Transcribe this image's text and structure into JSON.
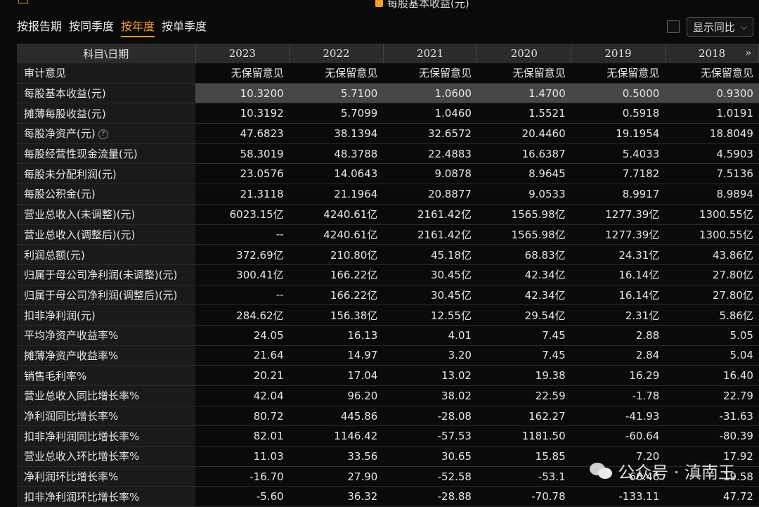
{
  "legend": {
    "right_label": "每股基本收益(元)",
    "right_color": "#f0a022"
  },
  "tabs": [
    {
      "label": "按报告期",
      "active": false
    },
    {
      "label": "按同季度",
      "active": false
    },
    {
      "label": "按年度",
      "active": true
    },
    {
      "label": "按单季度",
      "active": false
    }
  ],
  "controls": {
    "select_value": "显示同比",
    "caret": "⌵"
  },
  "table": {
    "header_label": "科目\\日期",
    "years": [
      "2023",
      "2022",
      "2021",
      "2020",
      "2019",
      "2018"
    ],
    "more_icon": "»",
    "rows": [
      {
        "label": "审计意见",
        "values": [
          "无保留意见",
          "无保留意见",
          "无保留意见",
          "无保留意见",
          "无保留意见",
          "无保留意见"
        ]
      },
      {
        "label": "每股基本收益(元)",
        "values": [
          "10.3200",
          "5.7100",
          "1.0600",
          "1.4700",
          "0.5000",
          "0.9300"
        ],
        "highlight": true
      },
      {
        "label": "摊薄每股收益(元)",
        "values": [
          "10.3192",
          "5.7099",
          "1.0460",
          "1.5521",
          "0.5918",
          "1.0191"
        ]
      },
      {
        "label": "每股净资产(元)",
        "values": [
          "47.6823",
          "38.1394",
          "32.6572",
          "20.4460",
          "19.1954",
          "18.8049"
        ],
        "info": true
      },
      {
        "label": "每股经营性现金流量(元)",
        "values": [
          "58.3019",
          "48.3788",
          "22.4883",
          "16.6387",
          "5.4033",
          "4.5903"
        ]
      },
      {
        "label": "每股未分配利润(元)",
        "values": [
          "23.0576",
          "14.0643",
          "9.0878",
          "8.9645",
          "7.7182",
          "7.5136"
        ]
      },
      {
        "label": "每股公积金(元)",
        "values": [
          "21.3118",
          "21.1964",
          "20.8877",
          "9.0533",
          "8.9917",
          "8.9894"
        ]
      },
      {
        "label": "营业总收入(未调整)(元)",
        "values": [
          "6023.15亿",
          "4240.61亿",
          "2161.42亿",
          "1565.98亿",
          "1277.39亿",
          "1300.55亿"
        ]
      },
      {
        "label": "营业总收入(调整后)(元)",
        "values": [
          "--",
          "4240.61亿",
          "2161.42亿",
          "1565.98亿",
          "1277.39亿",
          "1300.55亿"
        ]
      },
      {
        "label": "利润总额(元)",
        "values": [
          "372.69亿",
          "210.80亿",
          "45.18亿",
          "68.83亿",
          "24.31亿",
          "43.86亿"
        ]
      },
      {
        "label": "归属于母公司净利润(未调整)(元)",
        "values": [
          "300.41亿",
          "166.22亿",
          "30.45亿",
          "42.34亿",
          "16.14亿",
          "27.80亿"
        ]
      },
      {
        "label": "归属于母公司净利润(调整后)(元)",
        "values": [
          "--",
          "166.22亿",
          "30.45亿",
          "42.34亿",
          "16.14亿",
          "27.80亿"
        ]
      },
      {
        "label": "扣非净利润(元)",
        "values": [
          "284.62亿",
          "156.38亿",
          "12.55亿",
          "29.54亿",
          "2.31亿",
          "5.86亿"
        ]
      },
      {
        "label": "平均净资产收益率%",
        "values": [
          "24.05",
          "16.13",
          "4.01",
          "7.45",
          "2.88",
          "5.05"
        ]
      },
      {
        "label": "摊薄净资产收益率%",
        "values": [
          "21.64",
          "14.97",
          "3.20",
          "7.45",
          "2.84",
          "5.04"
        ]
      },
      {
        "label": "销售毛利率%",
        "values": [
          "20.21",
          "17.04",
          "13.02",
          "19.38",
          "16.29",
          "16.40"
        ]
      },
      {
        "label": "营业总收入同比增长率%",
        "values": [
          "42.04",
          "96.20",
          "38.02",
          "22.59",
          "-1.78",
          "22.79"
        ]
      },
      {
        "label": "净利润同比增长率%",
        "values": [
          "80.72",
          "445.86",
          "-28.08",
          "162.27",
          "-41.93",
          "-31.63"
        ]
      },
      {
        "label": "扣非净利润同比增长率%",
        "values": [
          "82.01",
          "1146.42",
          "-57.53",
          "1181.50",
          "-60.64",
          "-80.39"
        ]
      },
      {
        "label": "营业总收入环比增长率%",
        "values": [
          "11.03",
          "33.56",
          "30.65",
          "15.85",
          "7.20",
          "17.92"
        ]
      },
      {
        "label": "净利润环比增长率%",
        "values": [
          "-16.70",
          "27.90",
          "-52.58",
          "-53.1",
          "-66.46",
          "19.58"
        ]
      },
      {
        "label": "扣非净利润环比增长率%",
        "values": [
          "-5.60",
          "36.32",
          "-28.88",
          "-70.78",
          "-133.11",
          "47.72"
        ]
      }
    ]
  },
  "watermark": {
    "text": "公众号 · 滇南王"
  }
}
